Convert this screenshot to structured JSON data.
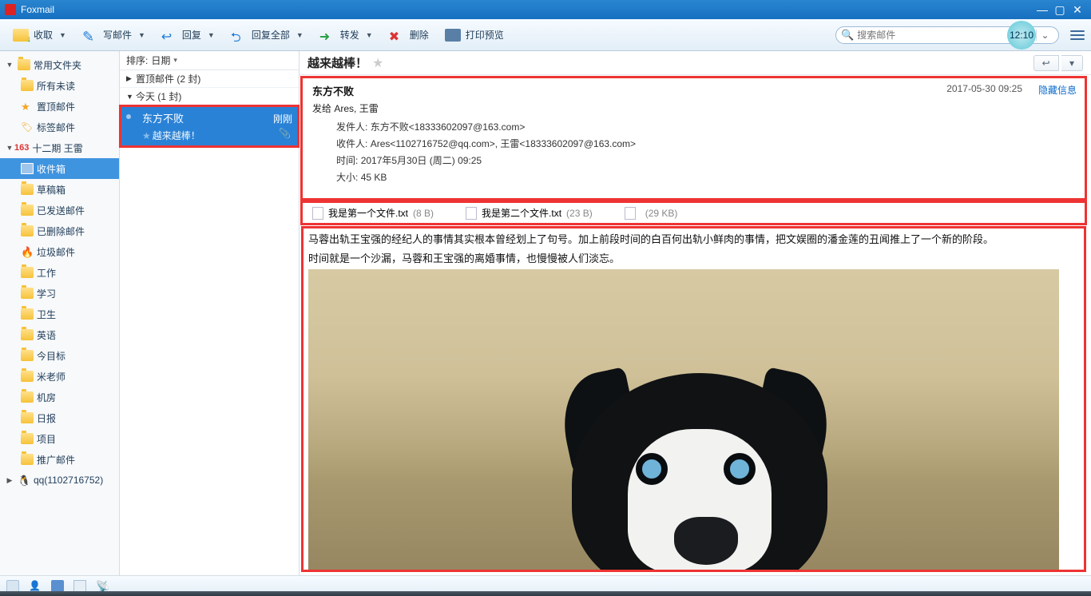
{
  "app": {
    "title": "Foxmail"
  },
  "toolbar": {
    "receive": "收取",
    "compose": "写邮件",
    "reply": "回复",
    "reply_all": "回复全部",
    "forward": "转发",
    "delete": "删除",
    "print_preview": "打印预览"
  },
  "search": {
    "placeholder": "搜索邮件"
  },
  "clock": {
    "time": "12:10"
  },
  "sidebar": {
    "common_folders": "常用文件夹",
    "all_unread": "所有未读",
    "pinned": "置顶邮件",
    "tagged": "标签邮件",
    "account1_badge": "163",
    "account1_name": "十二期 王雷",
    "inbox": "收件箱",
    "drafts": "草稿箱",
    "sent": "已发送邮件",
    "deleted": "已删除邮件",
    "junk": "垃圾邮件",
    "f_work": "工作",
    "f_study": "学习",
    "f_health": "卫生",
    "f_english": "英语",
    "f_goals": "今目标",
    "f_milaoshi": "米老师",
    "f_machineroom": "机房",
    "f_daily": "日报",
    "f_project": "项目",
    "f_promo": "推广邮件",
    "account2": "qq(1102716752)"
  },
  "list": {
    "sort_label": "排序:",
    "sort_field": "日期",
    "group_pinned": "置顶邮件 (2 封)",
    "group_today": "今天 (1 封)",
    "msg_from": "东方不败",
    "msg_subject": "越来越棒！",
    "msg_time": "刚刚"
  },
  "reader": {
    "subject": "越来越棒！",
    "from_name": "东方不败",
    "to_label": "发给",
    "to_names": "Ares, 王雷",
    "date_short": "2017-05-30 09:25",
    "hide_info": "隐藏信息",
    "sender_label": "发件人:",
    "sender_value": "东方不败<18333602097@163.com>",
    "recipient_label": "收件人:",
    "recipient_value": "Ares<1102716752@qq.com>,  王雷<18333602097@163.com>",
    "time_label": "时间:",
    "time_value": "2017年5月30日 (周二) 09:25",
    "size_label": "大小:",
    "size_value": "45 KB",
    "attachments": [
      {
        "name": "我是第一个文件.txt",
        "size": "(8 B)"
      },
      {
        "name": "我是第二个文件.txt",
        "size": "(23 B)"
      },
      {
        "name": "",
        "size": "(29 KB)"
      }
    ],
    "body_p1": "马蓉出轨王宝强的经纪人的事情其实根本曾经划上了句号。加上前段时间的白百何出轨小鲜肉的事情，把文娱圈的潘金莲的丑闻推上了一个新的阶段。",
    "body_p2": "时间就是一个沙漏，马蓉和王宝强的离婚事情，也慢慢被人们淡忘。"
  }
}
